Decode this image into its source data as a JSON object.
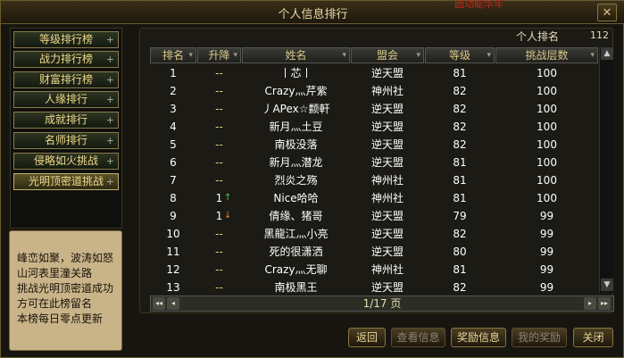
{
  "window": {
    "title": "个人信息排行",
    "corner_text": "圆动能华年"
  },
  "nav": [
    {
      "label": "等级排行榜",
      "plus": "+"
    },
    {
      "label": "战力排行榜",
      "plus": "+"
    },
    {
      "label": "财富排行榜",
      "plus": "+"
    },
    {
      "label": "人缘排行",
      "plus": "+"
    },
    {
      "label": "成就排行",
      "plus": "+"
    },
    {
      "label": "名师排行",
      "plus": "+"
    },
    {
      "label": "侵略如火挑战",
      "plus": "+"
    },
    {
      "label": "光明顶密道挑战",
      "plus": "+"
    }
  ],
  "scroll_text": "峰峦如聚，波涛如怒\n山河表里潼关路\n挑战光明顶密道成功\n方可在此榜留名\n本榜每日零点更新",
  "rank": {
    "label": "个人排名",
    "value": "112"
  },
  "columns": [
    "排名",
    "升降",
    "姓名",
    "盟会",
    "等级",
    "挑战层数"
  ],
  "rows": [
    {
      "rank": "1",
      "change": "--",
      "name": "丨芯丨",
      "guild": "逆天盟",
      "level": "81",
      "floors": "100"
    },
    {
      "rank": "2",
      "change": "--",
      "name": "Crazy灬芹紫",
      "guild": "神州社",
      "level": "82",
      "floors": "100"
    },
    {
      "rank": "3",
      "change": "--",
      "name": "丿APex☆颣軒",
      "guild": "逆天盟",
      "level": "82",
      "floors": "100"
    },
    {
      "rank": "4",
      "change": "--",
      "name": "新月灬土豆",
      "guild": "逆天盟",
      "level": "82",
      "floors": "100"
    },
    {
      "rank": "5",
      "change": "--",
      "name": "南极没落",
      "guild": "逆天盟",
      "level": "82",
      "floors": "100"
    },
    {
      "rank": "6",
      "change": "--",
      "name": "新月灬潜龙",
      "guild": "逆天盟",
      "level": "81",
      "floors": "100"
    },
    {
      "rank": "7",
      "change": "--",
      "name": "烈炎之殇",
      "guild": "神州社",
      "level": "81",
      "floors": "100"
    },
    {
      "rank": "8",
      "change": "1",
      "dir": "up",
      "name": "Nice哈哈",
      "guild": "神州社",
      "level": "81",
      "floors": "100"
    },
    {
      "rank": "9",
      "change": "1",
      "dir": "down",
      "name": "倩缘、猪哥",
      "guild": "逆天盟",
      "level": "79",
      "floors": "99"
    },
    {
      "rank": "10",
      "change": "--",
      "name": "黑龍江灬小亮",
      "guild": "逆天盟",
      "level": "82",
      "floors": "99"
    },
    {
      "rank": "11",
      "change": "--",
      "name": "死的很潇洒",
      "guild": "逆天盟",
      "level": "80",
      "floors": "99"
    },
    {
      "rank": "12",
      "change": "--",
      "name": "Crazy灬无聊",
      "guild": "神州社",
      "level": "81",
      "floors": "99"
    },
    {
      "rank": "13",
      "change": "--",
      "name": "南极黑王",
      "guild": "逆天盟",
      "level": "82",
      "floors": "99"
    }
  ],
  "pager": {
    "text": "1/17 页",
    "first": "◂◂",
    "prev": "◂",
    "next": "▸",
    "last": "▸▸"
  },
  "buttons": {
    "back": "返回",
    "view": "查看信息",
    "reward": "奖励信息",
    "my_reward": "我的奖励",
    "close": "关闭"
  },
  "icons": {
    "close": "close-icon",
    "sort": "sort-arrow-icon",
    "up": "up-arrow-icon",
    "down": "down-arrow-icon"
  }
}
